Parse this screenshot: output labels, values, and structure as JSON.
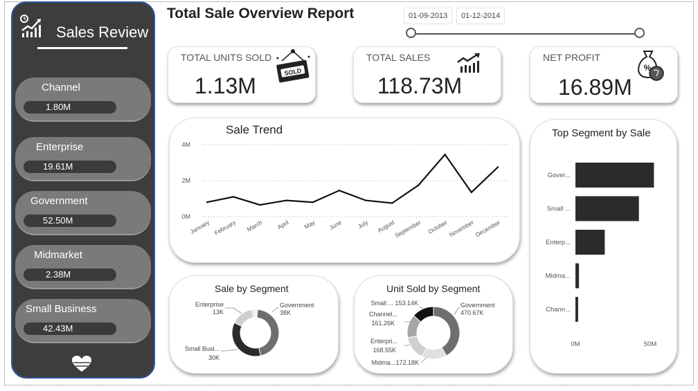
{
  "header": {
    "title": "Total Sale Overview Report",
    "date_start": "01-09-2013",
    "date_end": "01-12-2014"
  },
  "sidebar": {
    "brand": "Sales Review",
    "segments": [
      {
        "name": "Channel",
        "value": "1.80M"
      },
      {
        "name": "Enterprise",
        "value": "19.61M"
      },
      {
        "name": "Government",
        "value": "52.50M"
      },
      {
        "name": "Midmarket",
        "value": "2.38M"
      },
      {
        "name": "Small Business",
        "value": "42.43M"
      }
    ]
  },
  "kpis": {
    "units": {
      "label": "TOTAL UNITS SOLD",
      "value": "1.13M",
      "icon": "sold-sign-icon",
      "badge": "SOLD"
    },
    "sales": {
      "label": "TOTAL SALES",
      "value": "118.73M",
      "icon": "growth-chart-icon"
    },
    "profit": {
      "label": "NET PROFIT",
      "value": "16.89M",
      "icon": "money-bag-icon",
      "badge": "%"
    }
  },
  "colors": {
    "dark": "#2b2b2b",
    "mid": "#6e6e6e",
    "light": "#cfcfcf",
    "sidebar": "#3d3d3d",
    "border": "#2f5597"
  },
  "chart_data": [
    {
      "type": "line",
      "title": "Sale Trend",
      "categories": [
        "January",
        "February",
        "March",
        "April",
        "May",
        "June",
        "July",
        "August",
        "September",
        "October",
        "November",
        "December"
      ],
      "values": [
        0.8,
        1.1,
        0.65,
        0.9,
        0.8,
        1.45,
        0.9,
        0.75,
        1.75,
        3.45,
        1.35,
        2.75
      ],
      "yticks": [
        "0M",
        "2M",
        "4M"
      ],
      "ylim": [
        0,
        4
      ],
      "grid": true
    },
    {
      "type": "pie",
      "title": "Sale by Segment",
      "slices": [
        {
          "name": "Government",
          "label": "38K",
          "value": 38
        },
        {
          "name": "Small Busi...",
          "label": "30K",
          "value": 30
        },
        {
          "name": "Enterprise",
          "label": "13K",
          "value": 13
        },
        {
          "name": "",
          "label": "",
          "value": 1.7
        },
        {
          "name": "",
          "label": "",
          "value": 1.5
        }
      ]
    },
    {
      "type": "pie",
      "title": "Unit Sold by Segment",
      "slices": [
        {
          "name": "Government",
          "label": "470.67K",
          "value": 470.67
        },
        {
          "name": "Midma...",
          "label": "172.18K",
          "value": 172.18
        },
        {
          "name": "Enterpri...",
          "label": "168.55K",
          "value": 168.55
        },
        {
          "name": "Channel...",
          "label": "161.26K",
          "value": 161.26
        },
        {
          "name": "Small ...",
          "label": "153.14K",
          "value": 153.14
        }
      ]
    },
    {
      "type": "bar",
      "title": "Top Segment by Sale",
      "categories": [
        "Gover...",
        "Small ...",
        "Enterp...",
        "Midma...",
        "Chann..."
      ],
      "values": [
        52.5,
        42.43,
        19.61,
        2.38,
        1.8
      ],
      "xticks": [
        "0M",
        "50M"
      ],
      "xlim": [
        0,
        50
      ]
    }
  ]
}
